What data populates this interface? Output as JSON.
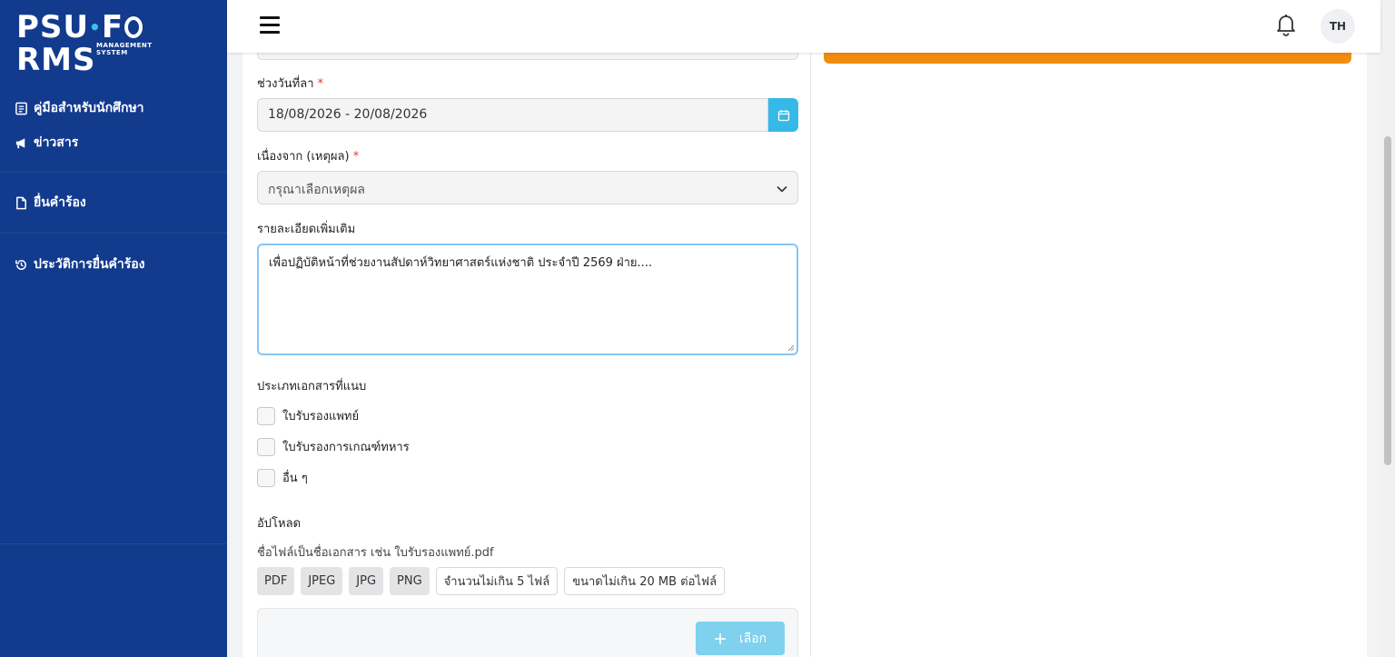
{
  "app": {
    "logo_text": "PSU FORMS",
    "logo_sub": "MANAGEMENT SYSTEM"
  },
  "sidebar": {
    "items": [
      {
        "label": "คู่มือสำหรับนักศึกษา",
        "icon": "book-icon"
      },
      {
        "label": "ข่าวสาร",
        "icon": "megaphone-icon"
      },
      {
        "label": "ยื่นคำร้อง",
        "icon": "file-icon"
      },
      {
        "label": "ประวัติการยื่นคำร้อง",
        "icon": "history-icon"
      }
    ]
  },
  "header": {
    "avatar": "TH"
  },
  "form": {
    "date_range_label": "ช่วงวันที่ลา",
    "required_mark": "*",
    "date_range_value": "18/08/2026 - 20/08/2026",
    "reason_label": "เนื่องจาก (เหตุผล)",
    "reason_placeholder": "กรุณาเลือกเหตุผล",
    "details_label": "รายละเอียดเพิ่มเติม",
    "details_value": "เพื่อปฏิบัติหน้าที่ช่วยงานสัปดาห์วิทยาศาสตร์แห่งชาติ ประจำปี 2569  ฝ่าย....",
    "doc_type_label": "ประเภทเอกสารที่แนบ",
    "doc_types": [
      {
        "label": "ใบรับรองแพทย์",
        "checked": false
      },
      {
        "label": "ใบรับรองการเกณฑ์ทหาร",
        "checked": false
      },
      {
        "label": "อื่น ๆ",
        "checked": false
      }
    ],
    "upload_label": "อัปโหลด",
    "upload_hint": "ชื่อไฟล์เป็นชื่อเอกสาร เช่น ใบรับรองแพทย์.pdf",
    "file_types": [
      "PDF",
      "JPEG",
      "JPG",
      "PNG"
    ],
    "limits": [
      "จำนวนไม่เกิน 5 ไฟล์",
      "ขนาดไม่เกิน 20 MB ต่อไฟล์"
    ],
    "choose_button": "เลือก"
  },
  "colors": {
    "sidebar_bg": "#123b8e",
    "accent_orange": "#f28c0f",
    "calendar_btn": "#36b9e6",
    "required_red": "#e53935"
  }
}
